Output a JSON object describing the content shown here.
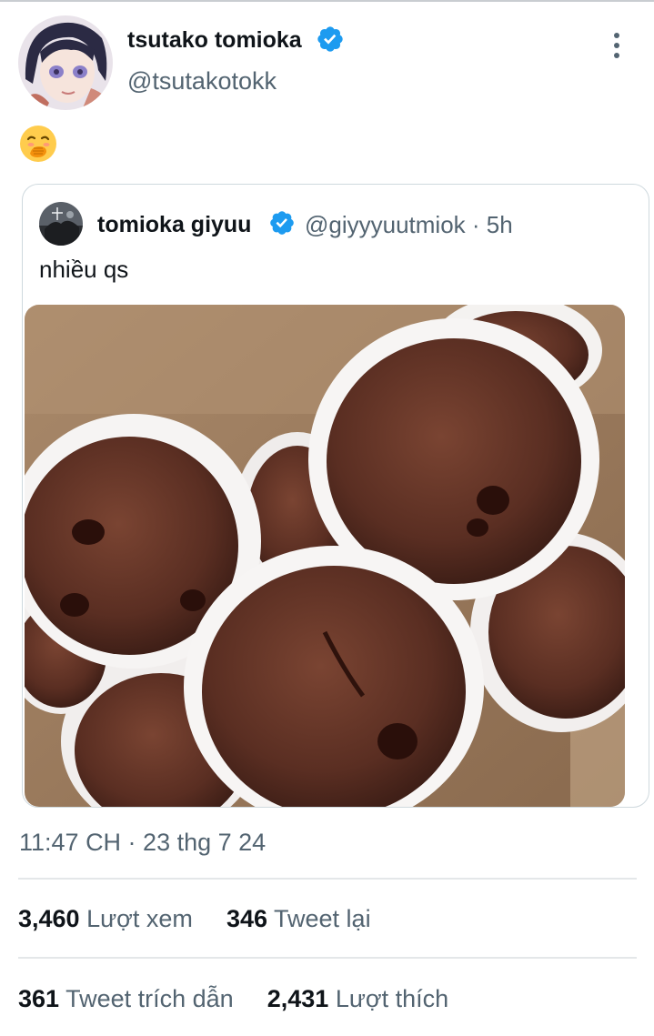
{
  "author": {
    "display_name": "tsutako tomioka",
    "handle": "@tsutakotokk"
  },
  "tweet": {
    "emoji": "🤭",
    "timestamp": "11:47 CH · 23 thg 7 24"
  },
  "quoted": {
    "display_name": "tomioka giyuu",
    "handle_time": "@giyyyuutmiok · 5h",
    "text": "nhiều qs"
  },
  "stats": {
    "views_count": "3,460",
    "views_label": "Lượt xem",
    "retweets_count": "346",
    "retweets_label": "Tweet lại",
    "quotes_count": "361",
    "quotes_label": "Tweet trích dẫn",
    "likes_count": "2,431",
    "likes_label": "Lượt thích"
  },
  "colors": {
    "verified_blue": "#1d9bf0",
    "secondary_text": "#536471",
    "primary_text": "#0f1419",
    "divider": "#e4e7e9"
  }
}
